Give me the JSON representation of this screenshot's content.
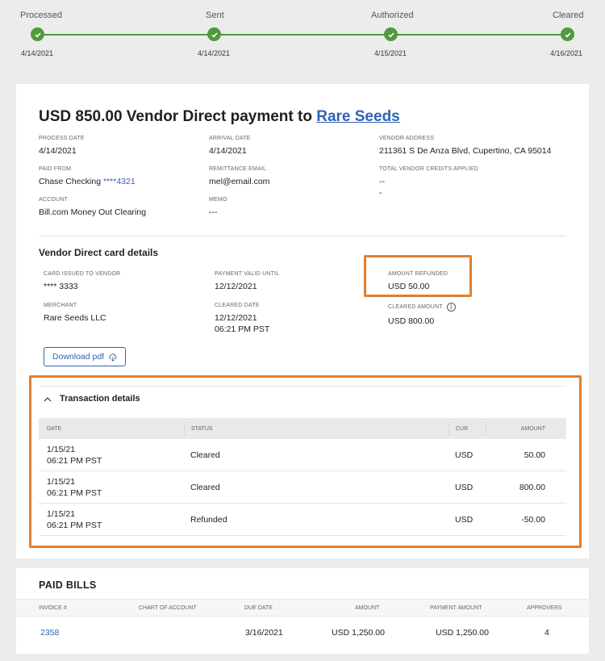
{
  "tracker": {
    "steps": [
      {
        "label": "Processed",
        "date": "4/14/2021"
      },
      {
        "label": "Sent",
        "date": "4/14/2021"
      },
      {
        "label": "Authorized",
        "date": "4/15/2021"
      },
      {
        "label": "Cleared",
        "date": "4/16/2021"
      }
    ],
    "progress_color": "#4f9a3e"
  },
  "payment": {
    "title_prefix": "USD 850.00 Vendor Direct payment to",
    "vendor": "Rare Seeds",
    "fields": {
      "process_date": {
        "label": "PROCESS DATE",
        "value": "4/14/2021"
      },
      "arrival_date": {
        "label": "ARRIVAL DATE",
        "value": "4/14/2021"
      },
      "vendor_address": {
        "label": "VENDOR ADDRESS",
        "value": "211361 S De Anza Blvd, Cupertino, CA 95014"
      },
      "paid_from": {
        "label": "PAID FROM",
        "value": "Chase Checking",
        "account_mask": "****4321"
      },
      "remittance_email": {
        "label": "REMITTANCE EMAIL",
        "value": "mel@email.com"
      },
      "vendor_credits": {
        "label": "TOTAL VENDOR CREDITS APPLIED",
        "value": "--",
        "value2": "-"
      },
      "account": {
        "label": "ACCOUNT",
        "value": "Bill.com Money Out Clearing"
      },
      "memo": {
        "label": "MEMO",
        "value": "---"
      }
    }
  },
  "card_details": {
    "title": "Vendor Direct card details",
    "card_issued": {
      "label": "CARD ISSUED TO VENDOR",
      "value": "**** 3333"
    },
    "payment_valid": {
      "label": "PAYMENT VALID UNTIL",
      "value": "12/12/2021"
    },
    "amount_refunded": {
      "label": "AMOUNT REFUNDED",
      "value": "USD 50.00"
    },
    "merchant": {
      "label": "MERCHANT",
      "value": "Rare Seeds LLC"
    },
    "cleared_date": {
      "label": "CLEARED DATE",
      "value": "12/12/2021",
      "time": "06:21 PM PST"
    },
    "cleared_amount": {
      "label": "CLEARED AMOUNT",
      "value": "USD 800.00"
    },
    "download_label": "Download pdf"
  },
  "transactions": {
    "title": "Transaction details",
    "columns": [
      "DATE",
      "STATUS",
      "CUR",
      "AMOUNT"
    ],
    "rows": [
      {
        "date": "1/15/21",
        "time": "06:21 PM PST",
        "status": "Cleared",
        "cur": "USD",
        "amount": "50.00"
      },
      {
        "date": "1/15/21",
        "time": "06:21 PM PST",
        "status": "Cleared",
        "cur": "USD",
        "amount": "800.00"
      },
      {
        "date": "1/15/21",
        "time": "06:21 PM PST",
        "status": "Refunded",
        "cur": "USD",
        "amount": "-50.00"
      }
    ]
  },
  "paid_bills": {
    "title": "PAID BILLS",
    "columns": [
      "INVOICE #",
      "CHART OF ACCOUNT",
      "DUE DATE",
      "AMOUNT",
      "PAYMENT AMOUNT",
      "APPROVERS"
    ],
    "rows": [
      {
        "invoice": "2358",
        "chart": "",
        "due": "3/16/2021",
        "amount": "USD 1,250.00",
        "payment": "USD 1,250.00",
        "approvers": "4"
      }
    ]
  },
  "colors": {
    "link": "#2f63b5",
    "highlight": "#e07f2d",
    "success": "#4f9a3e"
  }
}
